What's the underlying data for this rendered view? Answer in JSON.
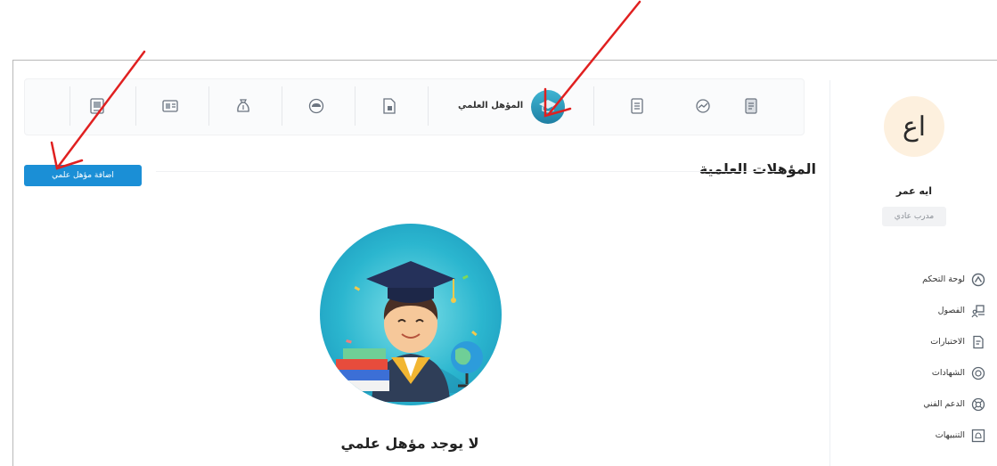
{
  "sidebar": {
    "avatar_initials": "اع",
    "user_name": "ايه عمر",
    "user_role": "مدرب عادي",
    "items": [
      {
        "label": "لوحة التحكم",
        "icon": "dashboard-icon"
      },
      {
        "label": "الفصول",
        "icon": "classroom-icon"
      },
      {
        "label": "الاختبارات",
        "icon": "exam-icon"
      },
      {
        "label": "الشهادات",
        "icon": "certificate-icon"
      },
      {
        "label": "الدعم الفني",
        "icon": "support-icon"
      },
      {
        "label": "التنبيهات",
        "icon": "notifications-icon"
      }
    ]
  },
  "topbar": {
    "active_label": "المؤهل العلمي",
    "icons": [
      "document-icon",
      "chart-icon",
      "list-icon",
      "graduation-cap-icon",
      "file-icon",
      "cloud-icon",
      "money-bag-icon",
      "id-card-icon",
      "image-icon"
    ]
  },
  "main": {
    "section_title": "المؤهلات العلمية",
    "add_button": "اضافة مؤهل علمي",
    "empty_title": "لا يوجد مؤهل علمي",
    "empty_subtitle": ""
  },
  "colors": {
    "accent": "#1b8fd6",
    "active_tab": "#2a9fc4",
    "annotation_arrow": "#e02020"
  }
}
